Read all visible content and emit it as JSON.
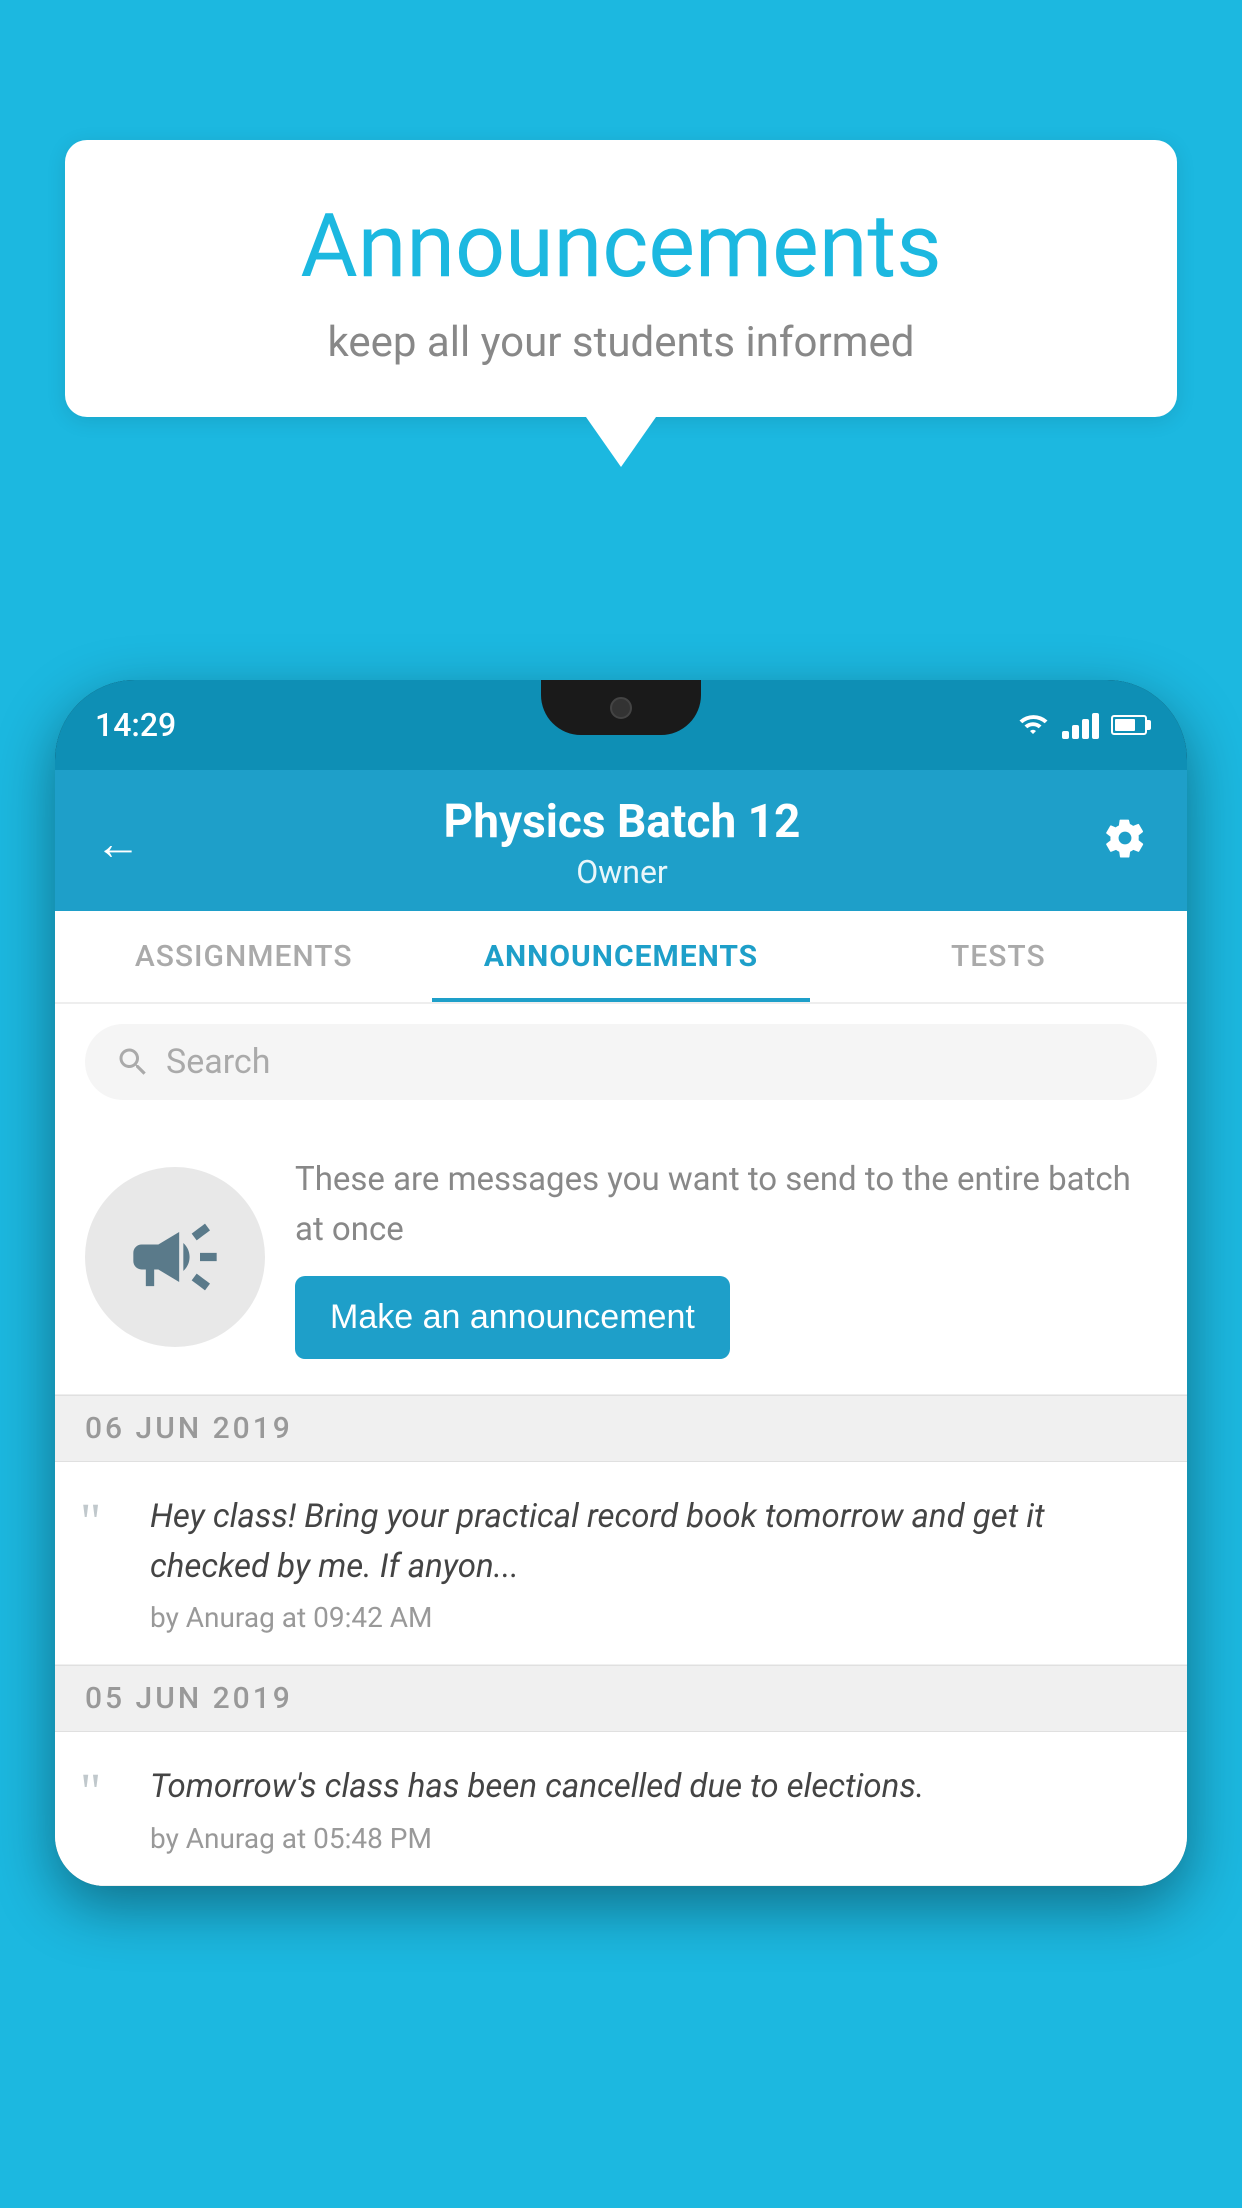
{
  "background_color": "#1cb8e0",
  "speech_bubble": {
    "title": "Announcements",
    "subtitle": "keep all your students informed"
  },
  "phone": {
    "status_bar": {
      "time": "14:29"
    },
    "header": {
      "back_label": "←",
      "title": "Physics Batch 12",
      "subtitle": "Owner",
      "gear_label": "⚙"
    },
    "tabs": [
      {
        "label": "ASSIGNMENTS",
        "active": false
      },
      {
        "label": "ANNOUNCEMENTS",
        "active": true
      },
      {
        "label": "TESTS",
        "active": false
      }
    ],
    "search": {
      "placeholder": "Search"
    },
    "promo": {
      "description": "These are messages you want to send to the entire batch at once",
      "button_label": "Make an announcement"
    },
    "announcements": [
      {
        "date": "06  JUN  2019",
        "text": "Hey class! Bring your practical record book tomorrow and get it checked by me. If anyon...",
        "meta": "by Anurag at 09:42 AM"
      },
      {
        "date": "05  JUN  2019",
        "text": "Tomorrow's class has been cancelled due to elections.",
        "meta": "by Anurag at 05:48 PM"
      }
    ]
  }
}
